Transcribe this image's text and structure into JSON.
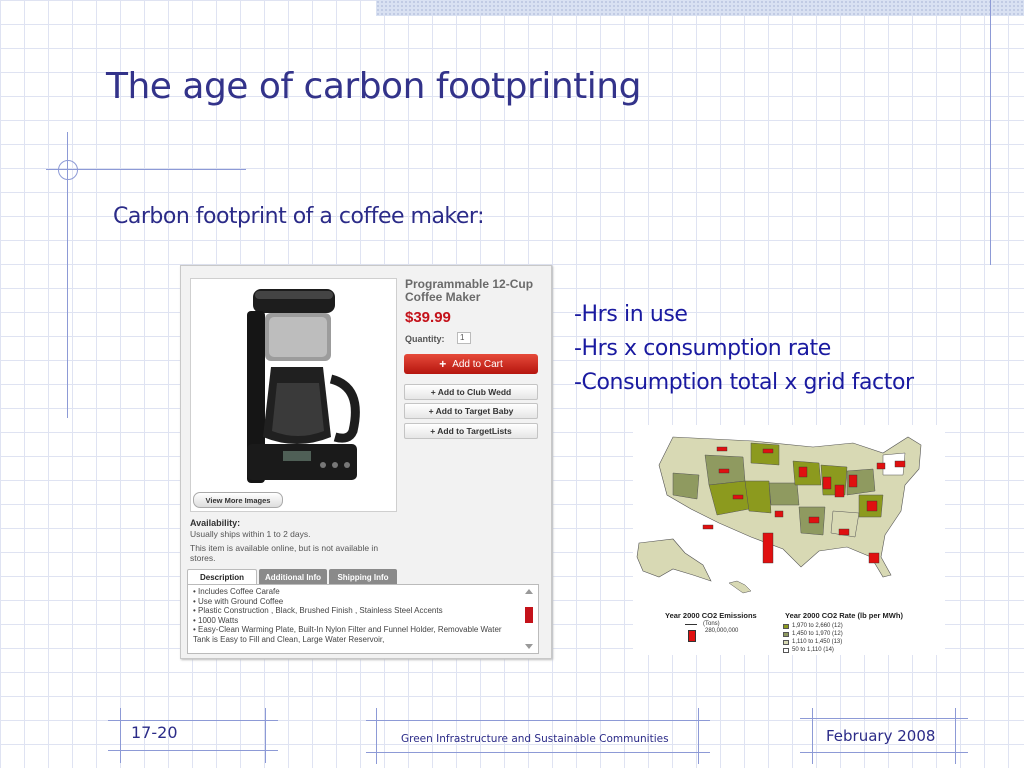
{
  "slide": {
    "title": "The age of carbon footprinting",
    "subtitle": "Carbon footprint of a coffee maker:",
    "bullets": [
      "-Hrs in use",
      "-Hrs x consumption rate",
      "-Consumption total x grid factor"
    ]
  },
  "product": {
    "name": "Programmable 12-Cup Coffee Maker",
    "price": "$39.99",
    "quantity_label": "Quantity:",
    "quantity_value": "1",
    "add_to_cart": "Add to Cart",
    "add_to_club": "+ Add to Club Wedd",
    "add_to_baby": "+ Add to Target Baby",
    "add_to_lists": "+ Add to TargetLists",
    "view_more": "View More Images",
    "availability_label": "Availability:",
    "availability_shipping": "Usually ships within 1 to 2 days.",
    "availability_online": "This item is available online, but is not available in stores.",
    "tabs": [
      "Description",
      "Additional Info",
      "Shipping Info"
    ],
    "description_items": [
      "• Includes Coffee Carafe",
      "• Use with Ground Coffee",
      "• Plastic Construction , Black, Brushed Finish , Stainless Steel Accents",
      "• 1000 Watts",
      "• Easy-Clean Warming Plate, Built-In Nylon Filter and Funnel Holder, Removable Water Tank is Easy to Fill and Clean, Large Water Reservoir,"
    ]
  },
  "map": {
    "emissions_title": "Year 2000 CO2 Emissions",
    "emissions_unit": "(Tons)",
    "emissions_value": "280,000,000",
    "rate_title": "Year 2000 CO2 Rate (lb per MWh)",
    "legend": [
      {
        "label": "1,970 to 2,660 (12)",
        "color": "#8c9a1e"
      },
      {
        "label": "1,450 to 1,970 (12)",
        "color": "#8f9a60"
      },
      {
        "label": "1,110 to 1,450 (13)",
        "color": "#d8d9b4"
      },
      {
        "label": "50 to 1,110 (14)",
        "color": "#ffffff"
      }
    ]
  },
  "footer": {
    "slide_number": "17-20",
    "course": "Green Infrastructure and Sustainable Communities",
    "date": "February 2008"
  },
  "colors": {
    "title": "#33338a",
    "bullet_text": "#1a1aa0",
    "accent_line": "#8d9ad6",
    "price_red": "#c4121a"
  }
}
